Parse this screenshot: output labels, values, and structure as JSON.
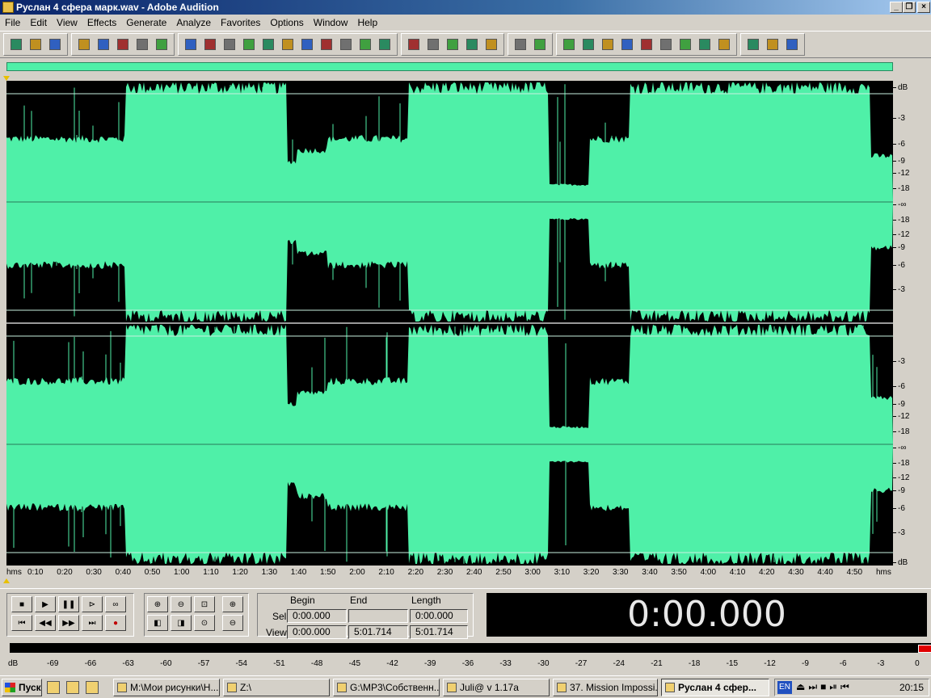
{
  "window": {
    "title": "Руслан 4 сфера марк.wav - Adobe Audition",
    "buttons": {
      "minimize": "_",
      "restore": "❐",
      "close": "×"
    }
  },
  "menu": [
    "File",
    "Edit",
    "View",
    "Effects",
    "Generate",
    "Analyze",
    "Favorites",
    "Options",
    "Window",
    "Help"
  ],
  "toolbar_icons": [
    [
      "waveform-icon",
      "multitrack-icon",
      "cd-icon"
    ],
    [
      "new-file-icon",
      "open-file-icon",
      "save-icon",
      "save-as-icon",
      "close-file-icon"
    ],
    [
      "undo-icon",
      "redo-icon",
      "cut-icon",
      "copy-icon",
      "paste-icon",
      "trim-icon",
      "mix-paste-icon",
      "markers-icon",
      "effects-icon",
      "analyze-icon",
      "loop-icon"
    ],
    [
      "envelope-icon",
      "snap-icon",
      "grid-icon",
      "tile-icon",
      "cascade-icon"
    ],
    [
      "cursor-icon",
      "select-icon"
    ],
    [
      "file-panel-icon",
      "effects-panel-icon",
      "favorites-panel-icon",
      "transport-panel-icon",
      "zoom-panel-icon",
      "time-panel-icon",
      "selection-panel-icon",
      "level-panel-icon",
      "status-panel-icon"
    ],
    [
      "settings-icon",
      "notes-icon",
      "help-icon"
    ]
  ],
  "waveform": {
    "fill_color": "#4ff0a8",
    "background_color": "#000000",
    "db_scale_top": [
      "dB",
      "-3",
      "-6",
      "-9",
      "-12",
      "-18",
      "-∞",
      "-18",
      "-12",
      "-9",
      "-6",
      "-3"
    ],
    "db_scale_bottom": [
      "-3",
      "-6",
      "-9",
      "-12",
      "-18",
      "-∞",
      "-18",
      "-12",
      "-9",
      "-6",
      "-3",
      "dB"
    ]
  },
  "ruler": {
    "unit": "hms",
    "labels": [
      "0:10",
      "0:20",
      "0:30",
      "0:40",
      "0:50",
      "1:00",
      "1:10",
      "1:20",
      "1:30",
      "1:40",
      "1:50",
      "2:00",
      "2:10",
      "2:20",
      "2:30",
      "2:40",
      "2:50",
      "3:00",
      "3:10",
      "3:20",
      "3:30",
      "3:40",
      "3:50",
      "4:00",
      "4:10",
      "4:20",
      "4:30",
      "4:40",
      "4:50"
    ]
  },
  "transport": {
    "buttons": [
      "stop-icon",
      "play-icon",
      "pause-icon",
      "play-to-end-icon",
      "loop-play-icon",
      "go-to-start-icon",
      "rewind-icon",
      "fast-forward-icon",
      "go-to-end-icon",
      "record-icon"
    ]
  },
  "zoom": {
    "buttons": [
      "zoom-in-horizontal-icon",
      "zoom-out-horizontal-icon",
      "zoom-full-icon",
      "zoom-in-vertical-icon",
      "zoom-left-icon",
      "zoom-right-icon",
      "zoom-selection-icon",
      "zoom-out-vertical-icon"
    ]
  },
  "selection": {
    "headers": {
      "begin": "Begin",
      "end": "End",
      "length": "Length"
    },
    "sel_label": "Sel",
    "view_label": "View",
    "sel": {
      "begin": "0:00.000",
      "end": "",
      "length": "0:00.000"
    },
    "view": {
      "begin": "0:00.000",
      "end": "5:01.714",
      "length": "5:01.714"
    }
  },
  "time_display": "0:00.000",
  "level_meter": {
    "labels": [
      "dB",
      "-69",
      "-66",
      "-63",
      "-60",
      "-57",
      "-54",
      "-51",
      "-48",
      "-45",
      "-42",
      "-39",
      "-36",
      "-33",
      "-30",
      "-27",
      "-24",
      "-21",
      "-18",
      "-15",
      "-12",
      "-9",
      "-6",
      "-3",
      "0"
    ]
  },
  "taskbar": {
    "start_label": "Пуск",
    "tasks": [
      {
        "label": "M:\\Мои рисунки\\Н...",
        "active": false
      },
      {
        "label": "Z:\\",
        "active": false
      },
      {
        "label": "G:\\MP3\\Собственн...",
        "active": false
      },
      {
        "label": "Juli@ v 1.17a",
        "active": false
      },
      {
        "label": "37. Mission Impossi...",
        "active": false
      },
      {
        "label": "Руслан 4 сфер...",
        "active": true
      }
    ],
    "lang": "EN",
    "clock": "20:15"
  }
}
